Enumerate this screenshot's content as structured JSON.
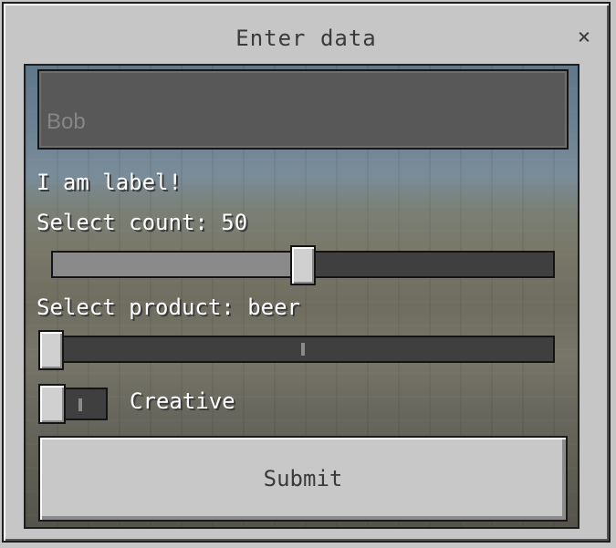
{
  "dialog": {
    "title": "Enter data",
    "close_icon": "close-icon",
    "close_glyph": "×"
  },
  "form": {
    "name_input": {
      "value": "",
      "placeholder": "Bob"
    },
    "static_label": "I am label!",
    "count_slider": {
      "label": "Select count: 50",
      "value": 50,
      "fraction": 0.5
    },
    "product_step_slider": {
      "label": "Select product: beer",
      "selected_index": 0,
      "options": [
        "beer"
      ]
    },
    "creative_toggle": {
      "label": "Creative",
      "on": false
    },
    "submit_label": "Submit"
  },
  "scroll": {
    "position": "bottom"
  },
  "colors": {
    "panel": "#c6c6c6",
    "input_bg": "#585858",
    "track": "#3f3f3f",
    "text_light": "#ffffff",
    "text_dark": "#3a3a3a"
  }
}
